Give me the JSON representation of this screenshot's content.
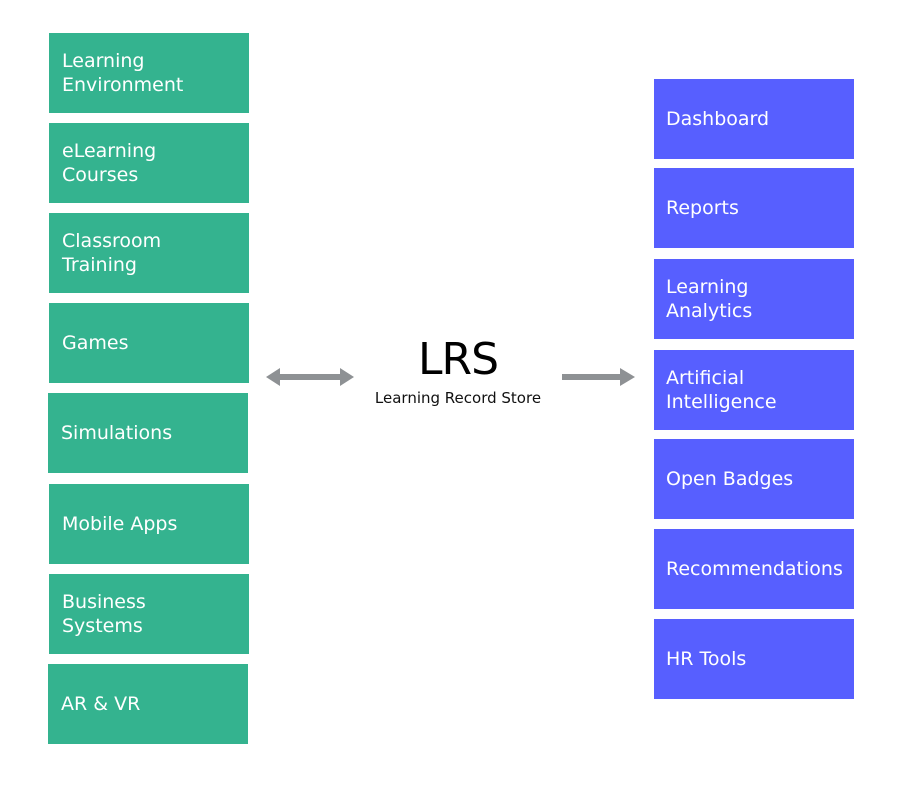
{
  "sources": [
    {
      "label": "Learning\nEnvironment"
    },
    {
      "label": "eLearning\nCourses"
    },
    {
      "label": "Classroom\nTraining"
    },
    {
      "label": "Games"
    },
    {
      "label": "Simulations"
    },
    {
      "label": "Mobile Apps"
    },
    {
      "label": "Business\nSystems"
    },
    {
      "label": "AR & VR"
    }
  ],
  "center": {
    "title": "LRS",
    "subtitle": "Learning Record Store"
  },
  "outputs": [
    {
      "label": "Dashboard"
    },
    {
      "label": "Reports"
    },
    {
      "label": "Learning\nAnalytics"
    },
    {
      "label": "Artificial\nIntelligence"
    },
    {
      "label": "Open Badges"
    },
    {
      "label": "Recommendations"
    },
    {
      "label": "HR Tools"
    }
  ],
  "connectors": {
    "left": "bidirectional-arrow",
    "right": "right-arrow"
  },
  "colors": {
    "source_box": "#34b38f",
    "output_box": "#575fff",
    "arrow": "#8e9194"
  }
}
